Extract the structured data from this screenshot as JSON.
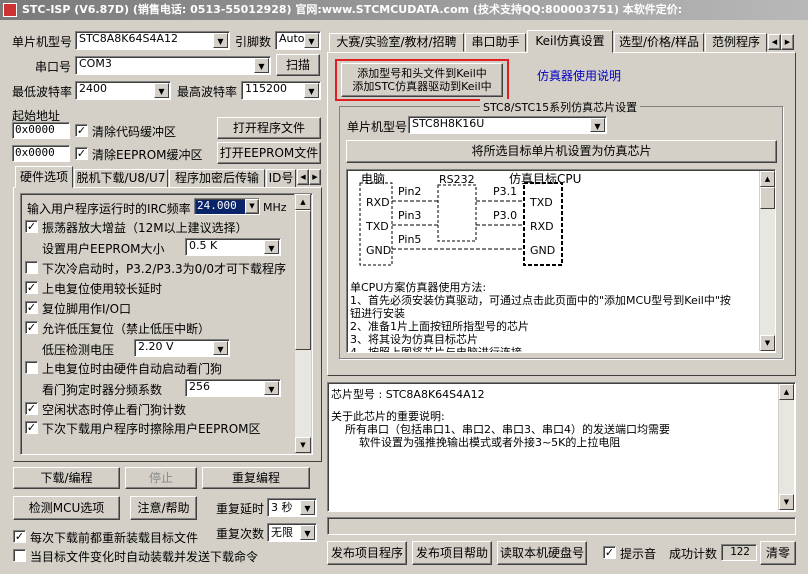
{
  "window": {
    "title": "STC-ISP (V6.87D) (销售电话: 0513-55012928) 官网:www.STCMCUDATA.com (技术支持QQ:800003751) 本软件定价: "
  },
  "left": {
    "mcu_type_label": "单片机型号",
    "mcu_type_value": "STC8A8K64S4A12",
    "pins_label": "引脚数",
    "pins_value": "Auto",
    "port_label": "串口号",
    "port_value": "COM3",
    "scan_button": "扫描",
    "min_baud_label": "最低波特率",
    "min_baud_value": "2400",
    "max_baud_label": "最高波特率",
    "max_baud_value": "115200",
    "start_addr_label": "起始地址",
    "addr1_value": "0x0000",
    "clear_code_label": "清除代码缓冲区",
    "open_program_button": "打开程序文件",
    "addr2_value": "0x0000",
    "clear_eeprom_label": "清除EEPROM缓冲区",
    "open_eeprom_button": "打开EEPROM文件",
    "tabs": [
      "硬件选项",
      "脱机下载/U8/U7",
      "程序加密后传输",
      "ID号"
    ],
    "options": {
      "irc_label": "输入用户程序运行时的IRC频率",
      "irc_value": "24.000",
      "irc_unit": "MHz",
      "amp_label": "振荡器放大增益（12M以上建议选择）",
      "eeprom_size_label": "设置用户EEPROM大小",
      "eeprom_size_value": "0.5 K",
      "p32_label": "下次冷启动时，P3.2/P3.3为0/0才可下载程序",
      "power_delay_label": "上电复位使用较长延时",
      "reset_pin_label": "复位脚用作I/O口",
      "low_volt_reset_label": "允许低压复位（禁止低压中断）",
      "low_volt_detect_label": "低压检测电压",
      "low_volt_detect_value": "2.20 V",
      "watchdog_label": "上电复位时由硬件自动启动看门狗",
      "wdt_div_label": "看门狗定时器分频系数",
      "wdt_div_value": "256",
      "idle_wdt_label": "空闲状态时停止看门狗计数",
      "erase_eeprom_label": "下次下载用户程序时擦除用户EEPROM区"
    },
    "download_button": "下载/编程",
    "stop_button": "停止",
    "reprogram_button": "重复编程",
    "check_mcu_button": "检测MCU选项",
    "help_button": "注意/帮助",
    "repeat_delay_label": "重复延时",
    "repeat_delay_value": "3 秒",
    "repeat_count_label": "重复次数",
    "repeat_count_value": "无限",
    "reload_label": "每次下载前都重新装载目标文件",
    "auto_reload_label": "当目标文件变化时自动装载并发送下载命令"
  },
  "right": {
    "tabs": [
      "大赛/实验室/教材/招聘",
      "串口助手",
      "Keil仿真设置",
      "选型/价格/样品",
      "范例程序"
    ],
    "active_tab": 2,
    "add_model_line1": "添加型号和头文件到Keil中",
    "add_model_line2": "添加STC仿真器驱动到Keil中",
    "emu_help_link": "仿真器使用说明",
    "group_title": "STC8/STC15系列仿真芯片设置",
    "emu_mcu_label": "单片机型号",
    "emu_mcu_value": "STC8H8K16U",
    "set_emu_button": "将所选目标单片机设置为仿真芯片",
    "diagram": {
      "pc_label": "电脑",
      "rs232_label": "RS232",
      "target_label": "仿真目标CPU",
      "rxd": "RXD",
      "txd": "TXD",
      "gnd": "GND",
      "pin2": "Pin2",
      "pin3": "Pin3",
      "pin5": "Pin5",
      "p31": "P3.1",
      "p30": "P3.0"
    },
    "emu_text": [
      "单CPU方案仿真器使用方法:",
      "1、首先必须安装仿真驱动，可通过点击此页面中的\"添加MCU型号到Keil中\"按",
      "钮进行安装",
      "2、准备1片上面按钮所指型号的芯片",
      "3、将其设为仿真目标芯片",
      "4、按照上图将芯片与电脑进行连接"
    ],
    "info_text": [
      "芯片型号 : STC8A8K64S4A12",
      "",
      "关于此芯片的重要说明:",
      "    所有串口（包括串口1、串口2、串口3、串口4）的发送端口均需要",
      "        软件设置为强推挽输出模式或者外接3~5K的上拉电阻"
    ],
    "publish_program_button": "发布项目程序",
    "publish_help_button": "发布项目帮助",
    "read_serial_button": "读取本机硬盘号",
    "sound_label": "提示音",
    "success_label": "成功计数",
    "success_value": "122",
    "clear_button": "清零"
  }
}
